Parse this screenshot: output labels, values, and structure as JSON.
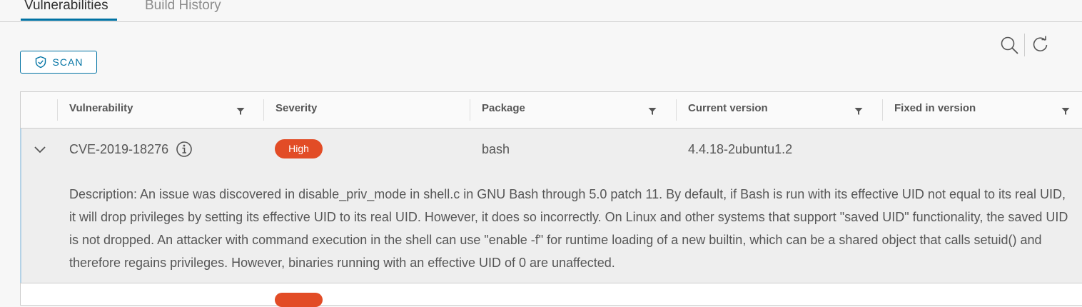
{
  "tabs": [
    {
      "label": "Vulnerabilities",
      "active": true
    },
    {
      "label": "Build History",
      "active": false
    }
  ],
  "toolbar": {
    "scan_label": "SCAN",
    "scan_icon": "shield-check-icon",
    "search_icon": "search-icon",
    "refresh_icon": "refresh-icon"
  },
  "table": {
    "columns": [
      {
        "label": "Vulnerability",
        "filter": true
      },
      {
        "label": "Severity",
        "filter": false
      },
      {
        "label": "Package",
        "filter": true
      },
      {
        "label": "Current version",
        "filter": true
      },
      {
        "label": "Fixed in version",
        "filter": true
      }
    ],
    "rows": [
      {
        "expanded": true,
        "vulnerability": "CVE-2019-18276",
        "severity": "High",
        "package": "bash",
        "current_version": "4.4.18-2ubuntu1.2",
        "fixed_version": "",
        "description": "Description: An issue was discovered in disable_priv_mode in shell.c in GNU Bash through 5.0 patch 11. By default, if Bash is run with its effective UID not equal to its real UID, it will drop privileges by setting its effective UID to its real UID. However, it does so incorrectly. On Linux and other systems that support \"saved UID\" functionality, the saved UID is not dropped. An attacker with command execution in the shell can use \"enable -f\" for runtime loading of a new builtin, which can be a shared object that calls setuid() and therefore regains privileges. However, binaries running with an effective UID of 0 are unaffected."
      }
    ]
  },
  "colors": {
    "accent": "#0072a3",
    "severity_high": "#e24c26"
  }
}
